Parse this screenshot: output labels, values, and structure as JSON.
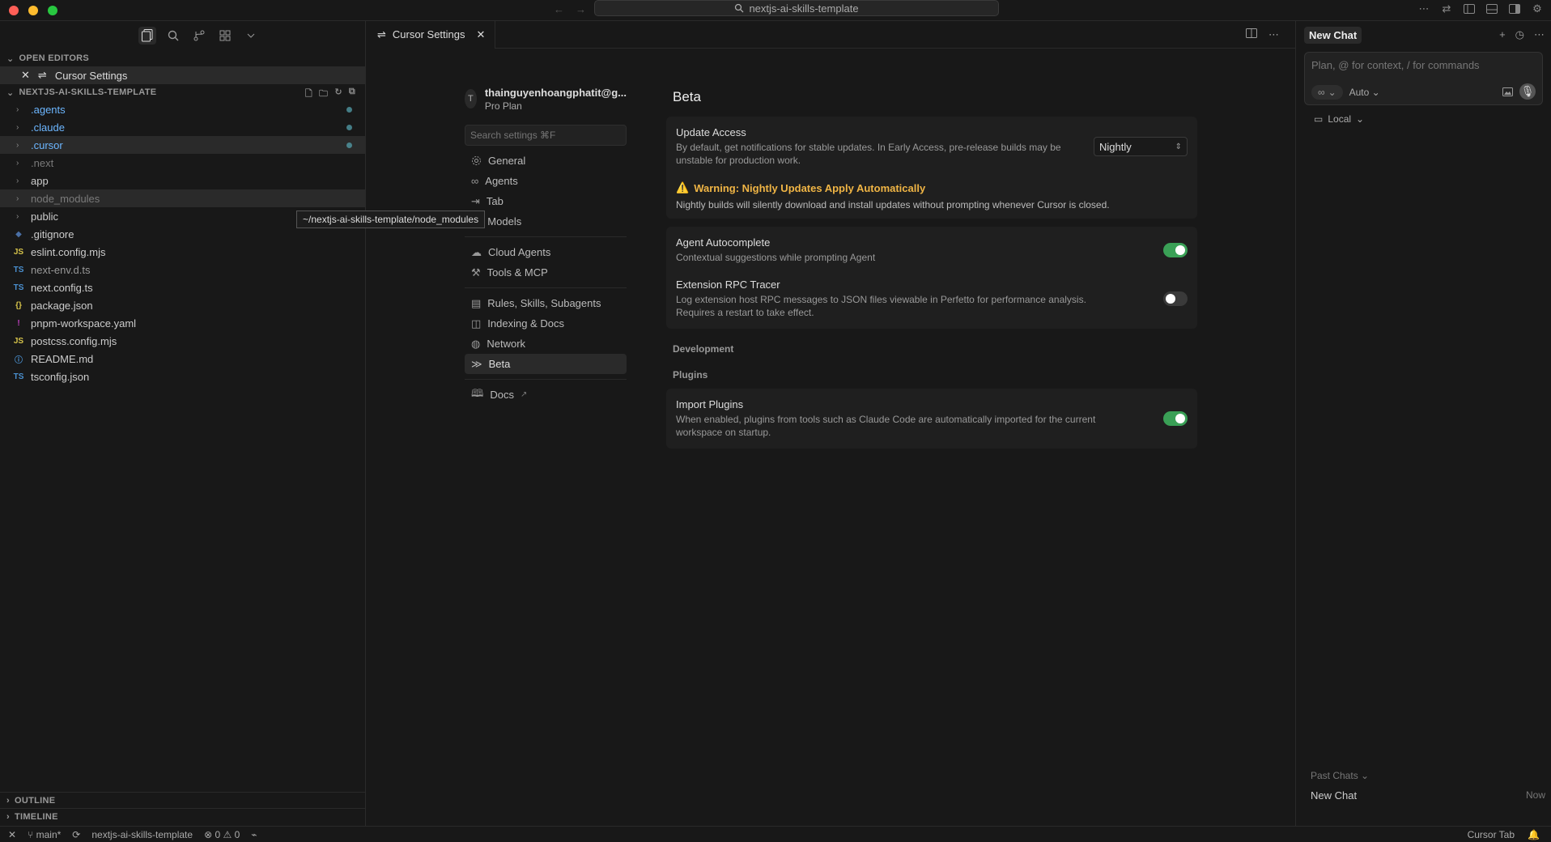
{
  "window": {
    "title": "nextjs-ai-skills-template"
  },
  "explorer": {
    "open_editors_label": "OPEN EDITORS",
    "open_editor_item": "Cursor Settings",
    "project_label": "NEXTJS-AI-SKILLS-TEMPLATE",
    "tooltip": "~/nextjs-ai-skills-template/node_modules",
    "folders": [
      {
        "name": ".agents",
        "color": "#6cb6ff"
      },
      {
        "name": ".claude",
        "color": "#6cb6ff"
      },
      {
        "name": ".cursor",
        "color": "#6cb6ff"
      },
      {
        "name": ".next",
        "color": "#7a7a7a"
      },
      {
        "name": "app",
        "color": "#cccccc"
      },
      {
        "name": "node_modules",
        "color": "#7a7a7a"
      },
      {
        "name": "public",
        "color": "#cccccc"
      }
    ],
    "files": [
      {
        "name": ".gitignore",
        "icon": "◆",
        "color": "#4a6fa5"
      },
      {
        "name": "eslint.config.mjs",
        "icon": "JS",
        "color": "#d6c34a"
      },
      {
        "name": "next-env.d.ts",
        "icon": "TS",
        "color": "#4a90d0"
      },
      {
        "name": "next.config.ts",
        "icon": "TS",
        "color": "#4a90d0"
      },
      {
        "name": "package.json",
        "icon": "{}",
        "color": "#d6c34a"
      },
      {
        "name": "pnpm-workspace.yaml",
        "icon": "!",
        "color": "#c040c0"
      },
      {
        "name": "postcss.config.mjs",
        "icon": "JS",
        "color": "#d6c34a"
      },
      {
        "name": "README.md",
        "icon": "ⓘ",
        "color": "#4a90d0"
      },
      {
        "name": "tsconfig.json",
        "icon": "TS",
        "color": "#4a90d0"
      }
    ],
    "outline_label": "OUTLINE",
    "timeline_label": "TIMELINE"
  },
  "editor": {
    "tab_label": "Cursor Settings"
  },
  "settings": {
    "account_initial": "T",
    "account_email": "thainguyenhoangphatit@g...",
    "account_plan": "Pro Plan",
    "search_placeholder": "Search settings ⌘F",
    "nav": [
      {
        "label": "General",
        "icon": "gear"
      },
      {
        "label": "Agents",
        "icon": "infinity"
      },
      {
        "label": "Tab",
        "icon": "tab"
      },
      {
        "label": "Models",
        "icon": "box"
      },
      {
        "label": "Cloud Agents",
        "icon": "cloud"
      },
      {
        "label": "Tools & MCP",
        "icon": "tools"
      },
      {
        "label": "Rules, Skills, Subagents",
        "icon": "doc"
      },
      {
        "label": "Indexing & Docs",
        "icon": "db"
      },
      {
        "label": "Network",
        "icon": "globe"
      },
      {
        "label": "Beta",
        "icon": "beta"
      },
      {
        "label": "Docs",
        "icon": "book"
      }
    ],
    "page_title": "Beta",
    "update_access": {
      "title": "Update Access",
      "desc": "By default, get notifications for stable updates. In Early Access, pre-release builds may be unstable for production work.",
      "value": "Nightly"
    },
    "warning": {
      "title": "Warning: Nightly Updates Apply Automatically",
      "desc": "Nightly builds will silently download and install updates without prompting whenever Cursor is closed."
    },
    "agent_autocomplete": {
      "title": "Agent Autocomplete",
      "desc": "Contextual suggestions while prompting Agent",
      "enabled": true
    },
    "rpc_tracer": {
      "title": "Extension RPC Tracer",
      "desc": "Log extension host RPC messages to JSON files viewable in Perfetto for performance analysis. Requires a restart to take effect.",
      "enabled": false
    },
    "development_label": "Development",
    "plugins_label": "Plugins",
    "import_plugins": {
      "title": "Import Plugins",
      "desc": "When enabled, plugins from tools such as Claude Code are automatically imported for the current workspace on startup.",
      "enabled": true
    }
  },
  "chat": {
    "tab_label": "New Chat",
    "input_placeholder": "Plan, @ for context, / for commands",
    "mode_label": "Auto",
    "location_label": "Local",
    "past_label": "Past Chats",
    "past_item": "New Chat",
    "past_time": "Now"
  },
  "status": {
    "branch": "main*",
    "project": "nextjs-ai-skills-template",
    "errors": "0",
    "warnings": "0",
    "right_label": "Cursor Tab"
  },
  "colors": {
    "accent_green": "#3aa056",
    "warning": "#f0b545"
  }
}
